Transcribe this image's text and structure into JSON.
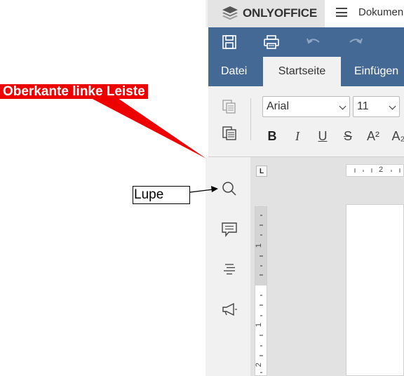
{
  "app": {
    "logo_text": "ONLYOFFICE",
    "doc_title": "Dokumen"
  },
  "tabs": {
    "file": "Datei",
    "home": "Startseite",
    "insert": "Einfügen"
  },
  "ribbon": {
    "font_name": "Arial",
    "font_size": "11",
    "bold": "B",
    "italic": "I",
    "underline": "U",
    "strike": "S",
    "superscript": "A²",
    "subscript": "A₂"
  },
  "ruler": {
    "corner": "L",
    "h_number": "2",
    "v_numbers": [
      "1",
      "1",
      "2"
    ]
  },
  "annotations": {
    "callout": "Oberkante linke Leiste",
    "lupe": "Lupe"
  },
  "colors": {
    "accent_blue": "#446995",
    "callout_red": "#ee0000"
  }
}
